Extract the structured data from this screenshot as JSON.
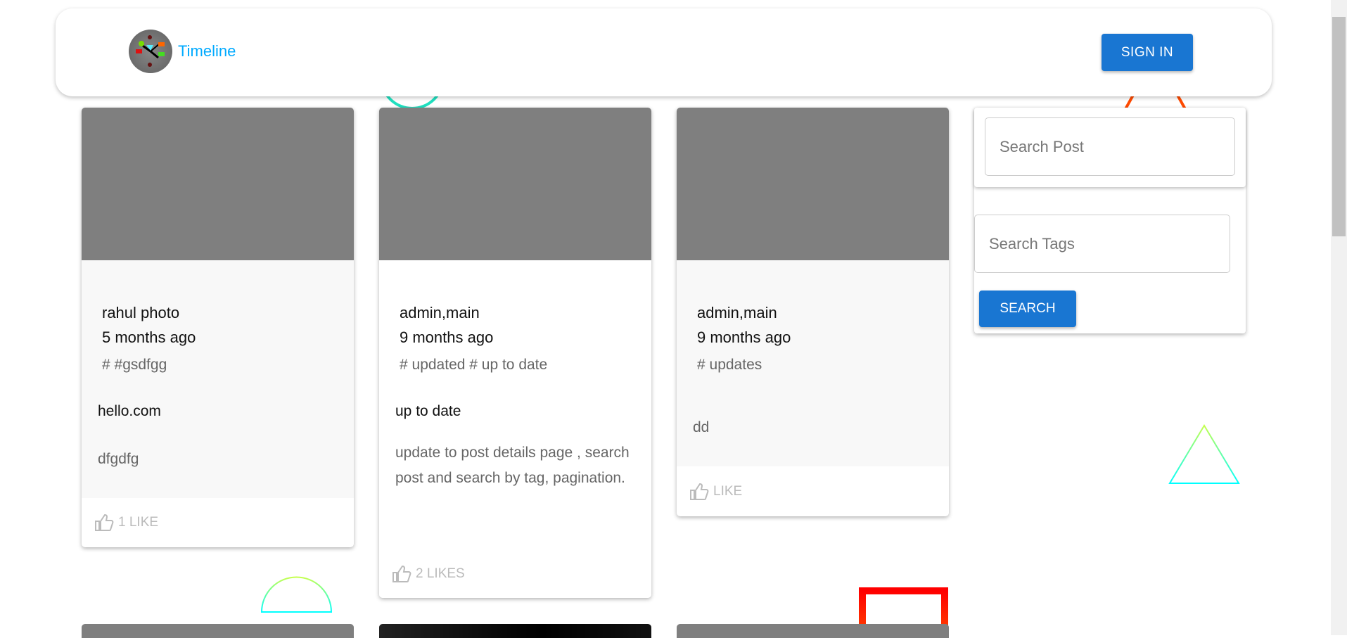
{
  "header": {
    "brand": "Timeline",
    "sign_in": "SIGN IN"
  },
  "posts": [
    {
      "author": "rahul photo",
      "time": "5 months ago",
      "tags": "# #gsdfgg",
      "title": "hello.com",
      "body": "dfgdfg",
      "likes": "1 LIKE"
    },
    {
      "author": "admin,main",
      "time": "9 months ago",
      "tags": "# updated # up to date",
      "title": "up to date",
      "body": "update to post details page , search post and search by tag, pagination.",
      "likes": "2 LIKES"
    },
    {
      "author": "admin,main",
      "time": "9 months ago",
      "tags": "# updates",
      "title": "",
      "body": "dd",
      "likes": "LIKE"
    }
  ],
  "search": {
    "post_placeholder": "Search Post",
    "tags_placeholder": "Search Tags",
    "button": "SEARCH"
  },
  "colors": {
    "accent": "#1976d2",
    "brand": "#00aaff"
  }
}
